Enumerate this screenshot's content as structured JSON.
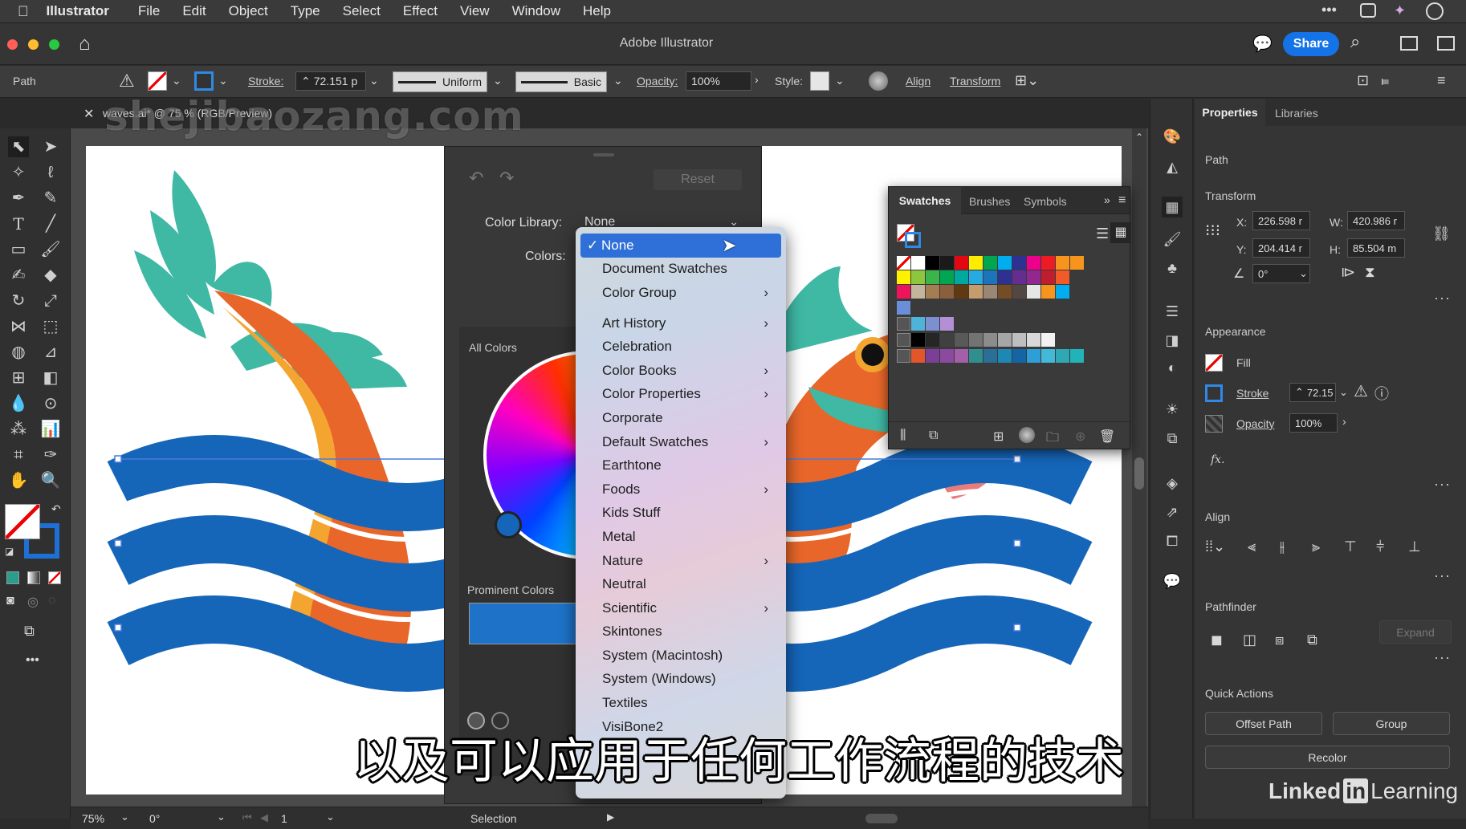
{
  "menubar": {
    "app": "Illustrator",
    "items": [
      "File",
      "Edit",
      "Object",
      "Type",
      "Select",
      "Effect",
      "View",
      "Window",
      "Help"
    ]
  },
  "titlebar": {
    "title": "Adobe Illustrator",
    "share": "Share"
  },
  "controlbar": {
    "selection_type": "Path",
    "stroke_label": "Stroke:",
    "stroke_value": "72.151 p",
    "profile": "Uniform",
    "brush": "Basic",
    "opacity_label": "Opacity:",
    "opacity_value": "100%",
    "style_label": "Style:",
    "align": "Align",
    "transform": "Transform"
  },
  "document": {
    "tab": "waves.ai* @ 75 % (RGB/Preview)"
  },
  "color_dialog": {
    "reset": "Reset",
    "color_library_label": "Color Library:",
    "color_library_value": "None",
    "colors_label": "Colors:",
    "all_colors": "All Colors",
    "prominent_colors": "Prominent Colors"
  },
  "dropdown": {
    "selected": "None",
    "items": [
      {
        "label": "Document Swatches",
        "sub": false
      },
      {
        "label": "Color Group",
        "sub": true
      },
      {
        "label": "Art History",
        "sub": true
      },
      {
        "label": "Celebration",
        "sub": false
      },
      {
        "label": "Color Books",
        "sub": true
      },
      {
        "label": "Color Properties",
        "sub": true
      },
      {
        "label": "Corporate",
        "sub": false
      },
      {
        "label": "Default Swatches",
        "sub": true
      },
      {
        "label": "Earthtone",
        "sub": false
      },
      {
        "label": "Foods",
        "sub": true
      },
      {
        "label": "Kids Stuff",
        "sub": false
      },
      {
        "label": "Metal",
        "sub": false
      },
      {
        "label": "Nature",
        "sub": true
      },
      {
        "label": "Neutral",
        "sub": false
      },
      {
        "label": "Scientific",
        "sub": true
      },
      {
        "label": "Skintones",
        "sub": false
      },
      {
        "label": "System (Macintosh)",
        "sub": false
      },
      {
        "label": "System (Windows)",
        "sub": false
      },
      {
        "label": "Textiles",
        "sub": false
      },
      {
        "label": "VisiBone2",
        "sub": false
      }
    ]
  },
  "swatches_panel": {
    "tabs": [
      "Swatches",
      "Brushes",
      "Symbols"
    ],
    "row1": [
      "#ffffff",
      "#000000",
      "#1a1a1a",
      "#e30613",
      "#ffed00",
      "#00a651",
      "#00aeef",
      "#2e3192",
      "#ec008c",
      "#ed1c24",
      "#f7941d",
      "#f7941d"
    ],
    "row2": [
      "#fff200",
      "#8dc63f",
      "#39b54a",
      "#00a651",
      "#00a99d",
      "#27aae1",
      "#1c75bc",
      "#2e3192",
      "#662d91",
      "#92278f",
      "#be1e2d",
      "#f15a29"
    ],
    "row3": [
      "#ed145b",
      "#c2b59b",
      "#a67c52",
      "#8b5e3c",
      "#603913",
      "#c69c6d",
      "#998675",
      "#754c24",
      "#534741",
      "#e6e6e6",
      "#f7941d",
      "#00aeef"
    ],
    "group1": [
      "#4fb3d9",
      "#7b8fd1",
      "#b48fd6"
    ],
    "group2": [
      "#000000",
      "#262626",
      "#404040",
      "#595959",
      "#737373",
      "#8c8c8c",
      "#a6a6a6",
      "#bfbfbf",
      "#d9d9d9",
      "#f2f2f2"
    ],
    "group3": [
      "#e2562a",
      "#7b3f98",
      "#8c4a9e",
      "#a35fa8",
      "#2f8f8f",
      "#2a6f97",
      "#1e88b5",
      "#1565a6",
      "#2e9fd6",
      "#43b8d9",
      "#30a7b5",
      "#22b3b8"
    ]
  },
  "properties": {
    "tabs": [
      "Properties",
      "Libraries"
    ],
    "object_type": "Path",
    "transform_header": "Transform",
    "x_label": "X:",
    "x_value": "226.598 r",
    "y_label": "Y:",
    "y_value": "204.414 r",
    "w_label": "W:",
    "w_value": "420.986 r",
    "h_label": "H:",
    "h_value": "85.504 m",
    "angle_value": "0°",
    "appearance_header": "Appearance",
    "fill": "Fill",
    "stroke": "Stroke",
    "stroke_value": "72.15",
    "opacity": "Opacity",
    "opacity_value": "100%",
    "fx": "fx.",
    "align_header": "Align",
    "pathfinder_header": "Pathfinder",
    "expand": "Expand",
    "quick_actions_header": "Quick Actions",
    "offset_path": "Offset Path",
    "group": "Group",
    "recolor": "Recolor"
  },
  "status": {
    "zoom": "75%",
    "rotation": "0°",
    "artboard": "1",
    "tool": "Selection"
  },
  "overlay": {
    "subtitle": "以及可以应用于任何工作流程的技术",
    "watermark": "shejibaozang.com",
    "brand": "Linked in Learning"
  },
  "colors": {
    "accent_blue": "#2f6fd8",
    "wave_blue": "#1565b8",
    "dragon_orange": "#e8662a",
    "dragon_teal": "#3fb8a4"
  }
}
